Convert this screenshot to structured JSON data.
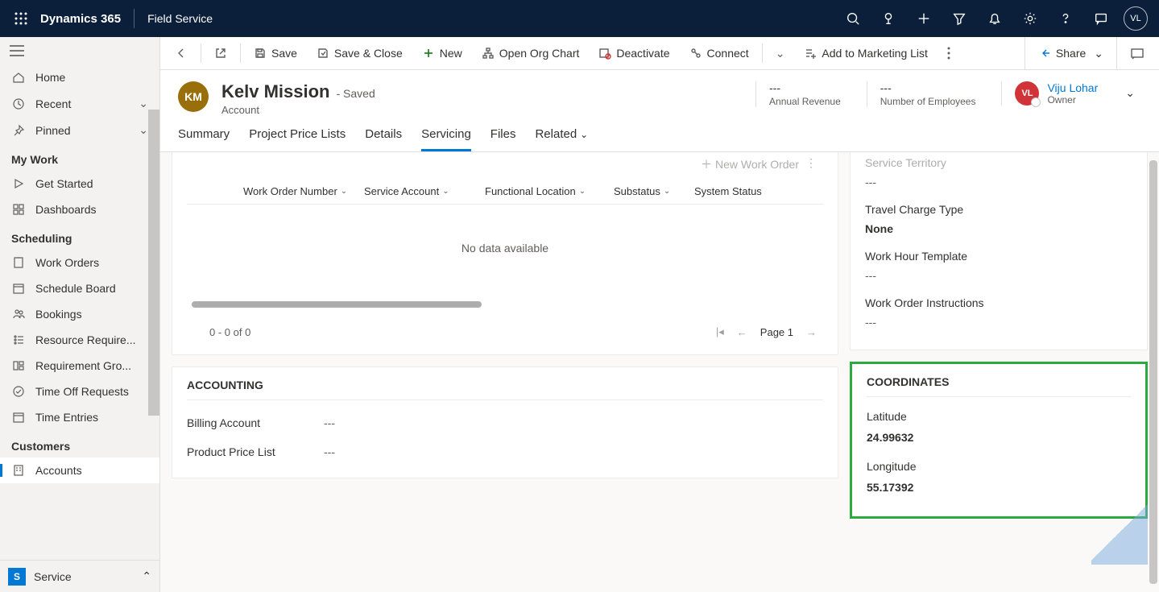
{
  "topbar": {
    "brand": "Dynamics 365",
    "app": "Field Service",
    "avatar_initials": "VL"
  },
  "sidebar": {
    "home": "Home",
    "recent": "Recent",
    "pinned": "Pinned",
    "section_mywork": "My Work",
    "get_started": "Get Started",
    "dashboards": "Dashboards",
    "section_scheduling": "Scheduling",
    "work_orders": "Work Orders",
    "schedule_board": "Schedule Board",
    "bookings": "Bookings",
    "resource_req": "Resource Require...",
    "requirement_groups": "Requirement Gro...",
    "time_off": "Time Off Requests",
    "time_entries": "Time Entries",
    "section_customers": "Customers",
    "accounts": "Accounts",
    "area_badge": "S",
    "area_label": "Service"
  },
  "cmdbar": {
    "save": "Save",
    "save_close": "Save & Close",
    "new": "New",
    "open_org": "Open Org Chart",
    "deactivate": "Deactivate",
    "connect": "Connect",
    "add_marketing": "Add to Marketing List",
    "share": "Share"
  },
  "header": {
    "avatar_initials": "KM",
    "name": "Kelv Mission",
    "status": "- Saved",
    "entity": "Account",
    "annual_revenue_val": "---",
    "annual_revenue_lbl": "Annual Revenue",
    "employees_val": "---",
    "employees_lbl": "Number of Employees",
    "owner_initials": "VL",
    "owner_name": "Viju Lohar",
    "owner_lbl": "Owner"
  },
  "tabs": {
    "summary": "Summary",
    "ppl": "Project Price Lists",
    "details": "Details",
    "servicing": "Servicing",
    "files": "Files",
    "related": "Related"
  },
  "grid": {
    "new_work_order": "New Work Order",
    "col_won": "Work Order Number",
    "col_sa": "Service Account",
    "col_fl": "Functional Location",
    "col_sub": "Substatus",
    "col_ss": "System Status",
    "empty": "No data available",
    "count": "0 - 0 of 0",
    "page": "Page 1"
  },
  "accounting": {
    "heading": "ACCOUNTING",
    "billing_lbl": "Billing Account",
    "billing_val": "---",
    "ppl_lbl": "Product Price List",
    "ppl_val": "---"
  },
  "right": {
    "service_territory_lbl": "Service Territory",
    "service_territory_val": "---",
    "travel_charge_lbl": "Travel Charge Type",
    "travel_charge_val": "None",
    "wht_lbl": "Work Hour Template",
    "wht_val": "---",
    "woi_lbl": "Work Order Instructions",
    "woi_val": "---"
  },
  "coordinates": {
    "heading": "COORDINATES",
    "lat_lbl": "Latitude",
    "lat_val": "24.99632",
    "lon_lbl": "Longitude",
    "lon_val": "55.17392"
  }
}
